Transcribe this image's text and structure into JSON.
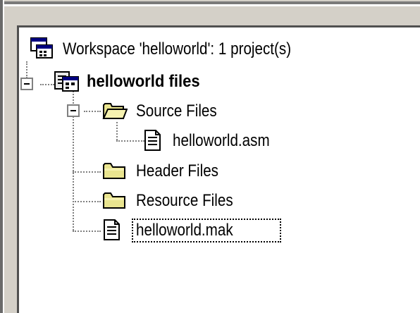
{
  "tree": {
    "workspace_label": "Workspace 'helloworld': 1 project(s)",
    "project_label": "helloworld files",
    "source_folder_label": "Source Files",
    "source_file_label": "helloworld.asm",
    "header_folder_label": "Header Files",
    "resource_folder_label": "Resource Files",
    "makefile_label": "helloworld.mak"
  },
  "colors": {
    "window_bg": "#d4d0c8",
    "panel_bg": "#ffffff",
    "folder_yellow": "#e9e48f",
    "tree_line": "#808080"
  }
}
